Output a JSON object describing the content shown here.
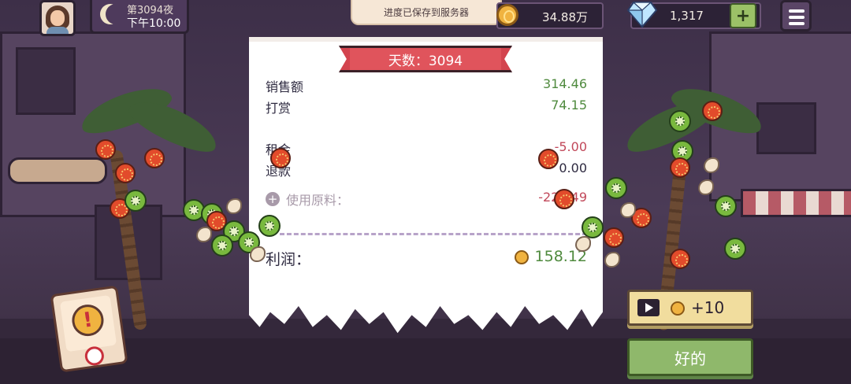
{
  "hud": {
    "night_label": "第3094夜",
    "time_label": "下午10:00",
    "coins": "34.88万",
    "gems": "1,317",
    "plus_label": "+"
  },
  "toast": {
    "text": "进度已保存到服务器"
  },
  "receipt": {
    "title": "天数：3094",
    "sales_label": "销售额",
    "sales_value": "314.46",
    "tips_label": "打赏",
    "tips_value": "74.15",
    "rent_label": "租金",
    "rent_value": "-5.00",
    "refund_label": "退款",
    "refund_value": "0.00",
    "ingredients_label": "使用原料：",
    "ingredients_value": "-225.49",
    "expand_label": "+",
    "profit_label": "利润：",
    "profit_value": "158.12"
  },
  "buttons": {
    "ad_reward": "+10",
    "ok_label": "好的",
    "alert_label": "!"
  },
  "colors": {
    "positive": "#4f8a3e",
    "negative": "#c1485a",
    "ribbon": "#e0545c",
    "ok_button": "#8fb86b",
    "ad_button": "#f1dd9e"
  },
  "icons": [
    "moon-icon",
    "coin-icon",
    "diamond-icon",
    "menu-icon",
    "play-video-icon",
    "alert-icon",
    "expand-icon"
  ]
}
